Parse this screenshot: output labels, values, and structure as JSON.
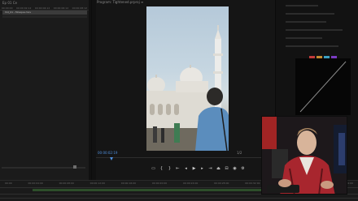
{
  "left_panel": {
    "title": "Ep 01 Ce",
    "ruler_ticks": [
      "00:00:00",
      "00:00:02:12",
      "00:00:04:12",
      "00:00:06:12",
      "00:00:08:12"
    ],
    "clip_label": "Vid_01 - Mosque.mov"
  },
  "program_monitor": {
    "title": "Program: Tightened.prproj ≡",
    "timecode": "00:00:02:19",
    "right_value": "1/2",
    "transport_icons": [
      "marker",
      "in-point",
      "out-point",
      "go-to-in",
      "step-back",
      "play",
      "step-forward",
      "go-to-out",
      "lift",
      "extract",
      "export-frame",
      "settings"
    ]
  },
  "timeline": {
    "ruler_ticks": [
      "00:00",
      "00:00:04:00",
      "00:00:08:00",
      "00:00:12:00",
      "00:00:16:00",
      "00:00:20:00",
      "00:00:24:00",
      "00:00:28:00",
      "00:00:32:00",
      "00:00:36:00",
      "00:00:40:00",
      "00:00:44:00"
    ]
  },
  "colors": {
    "accent_blue": "#4f8fdc",
    "swatches": [
      "#c23b3b",
      "#c48a2f",
      "#3ba0c2",
      "#7a3bc2"
    ]
  }
}
